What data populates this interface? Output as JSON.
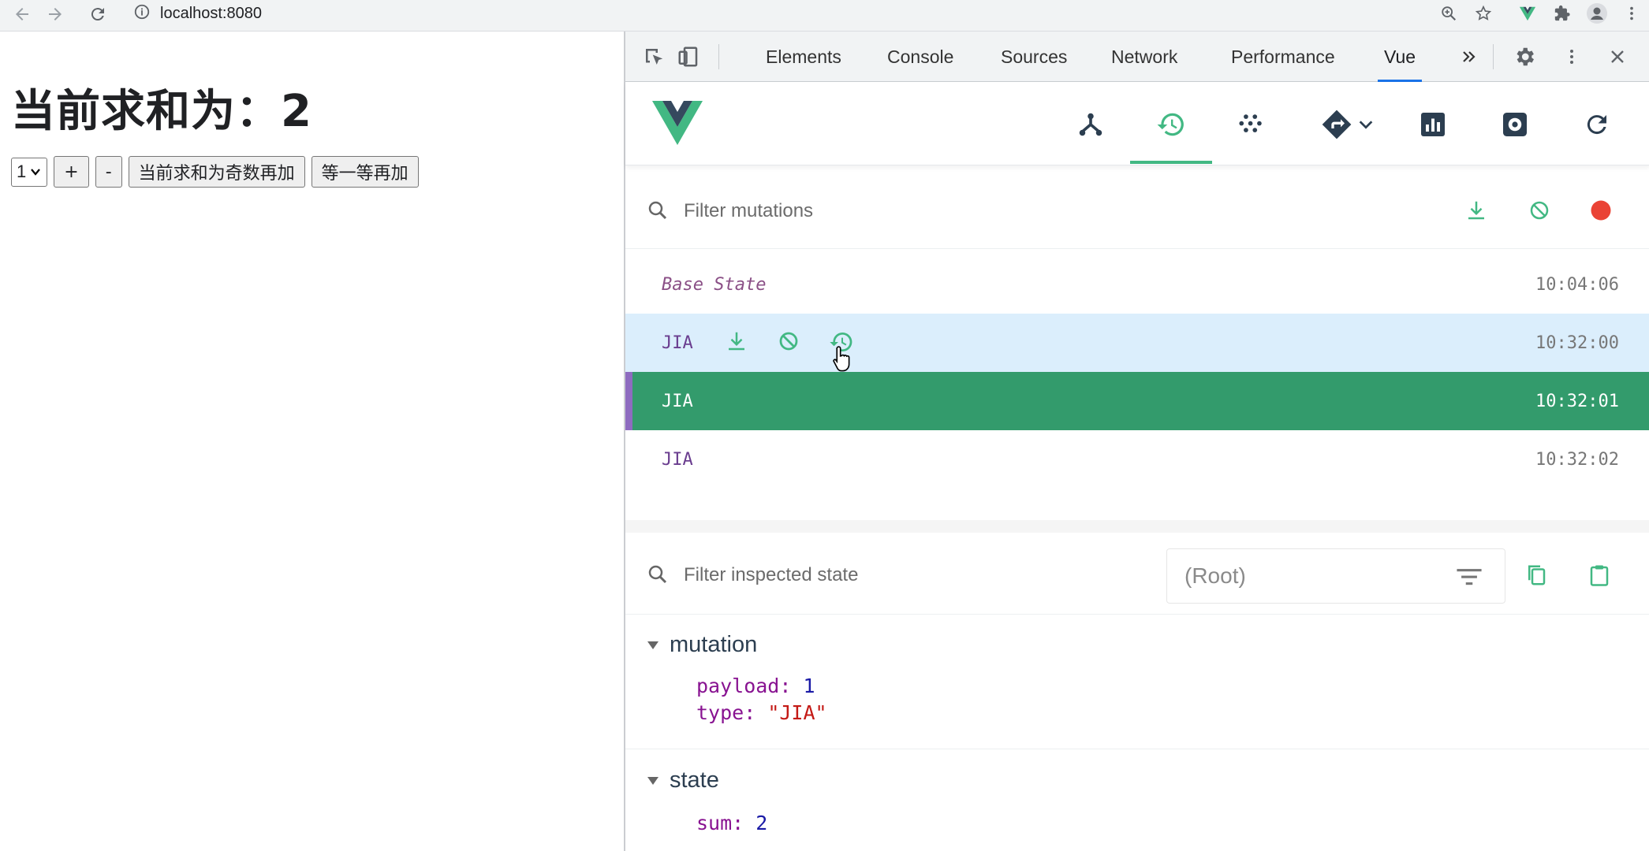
{
  "browser": {
    "url": "localhost:8080"
  },
  "page": {
    "heading": "当前求和为：2",
    "select_value": "1",
    "buttons": {
      "plus": "+",
      "minus": "-",
      "odd_add": "当前求和为奇数再加",
      "wait_add": "等一等再加"
    }
  },
  "devtools": {
    "tabs": [
      "Elements",
      "Console",
      "Sources",
      "Network",
      "Performance",
      "Vue"
    ],
    "active_tab": "Vue",
    "vue": {
      "mutation_filter_placeholder": "Filter mutations",
      "mutations": [
        {
          "label": "Base State",
          "time": "10:04:06"
        },
        {
          "label": "JIA",
          "time": "10:32:00"
        },
        {
          "label": "JIA",
          "time": "10:32:01"
        },
        {
          "label": "JIA",
          "time": "10:32:02"
        }
      ],
      "state_filter_placeholder": "Filter inspected state",
      "root_select": "(Root)",
      "sections": {
        "mutation": {
          "title": "mutation",
          "payload_key": "payload:",
          "payload_value": "1",
          "type_key": "type:",
          "type_value": "\"JIA\""
        },
        "state": {
          "title": "state",
          "sum_key": "sum:",
          "sum_value": "2"
        }
      }
    }
  },
  "colors": {
    "vue_green": "#42b883",
    "selected_row": "#339b6c",
    "hover_row": "#dbeefc",
    "record_red": "#ea4335",
    "accent_blue": "#1a73e8"
  }
}
